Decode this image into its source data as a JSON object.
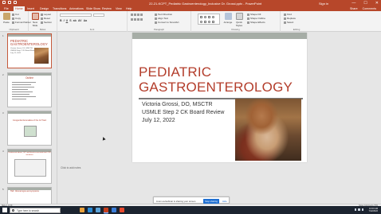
{
  "window": {
    "title": "22-21-KCPT_Pediatric Gastroenterology_Inclusive Dr. Grossi.pptx - PowerPoint",
    "signin": "Sign in",
    "controls": [
      "—",
      "☐",
      "✕"
    ]
  },
  "ribbon_tabs": [
    "File",
    "Home",
    "Insert",
    "Design",
    "Transitions",
    "Animations",
    "Slide Show",
    "Review",
    "View",
    "Help"
  ],
  "ribbon_right": [
    "Share",
    "Comments"
  ],
  "ribbon": {
    "clipboard": {
      "paste": "Paste",
      "cut": "Cut",
      "copy": "Copy",
      "format_painter": "Format Painter",
      "label": "Clipboard"
    },
    "slides": {
      "new_slide": "New Slide",
      "layout": "Layout",
      "reset": "Reset",
      "section": "Section",
      "label": "Slides"
    },
    "font": {
      "label": "Font",
      "format": [
        "B",
        "I",
        "U",
        "S",
        "ab",
        "AV",
        "Aa"
      ]
    },
    "paragraph": {
      "label": "Paragraph",
      "text_direction": "Text Direction",
      "align_text": "Align Text",
      "convert_smartart": "Convert to SmartArt"
    },
    "drawing": {
      "arrange": "Arrange",
      "quick_styles": "Quick Styles",
      "shape_fill": "Shape Fill",
      "shape_outline": "Shape Outline",
      "shape_effects": "Shape Effects",
      "label": "Drawing"
    },
    "editing": {
      "find": "Find",
      "replace": "Replace",
      "select": "Select",
      "label": "Editing"
    }
  },
  "thumbnails": [
    {
      "num": "1",
      "title": "PEDIATRIC GASTROENTEROLOGY",
      "sub": "Victoria Grossi, DO, MSCTR\nUSMLE Step 2 CK Board Review\nJuly 12, 2022"
    },
    {
      "num": "2",
      "title": "Outline"
    },
    {
      "num": "3",
      "title": "Congenital Anomalies of the GI Tract"
    },
    {
      "num": "4",
      "title": "Condensed above, GIT and bleed-associated fetal CKD variations"
    },
    {
      "num": "5",
      "title": "TEF: Clinical signs and symptoms"
    }
  ],
  "slide": {
    "title_line1": "PEDIATRIC",
    "title_line2": "GASTROENTEROLOGY",
    "author": "Victoria Grossi, DO, MSCTR",
    "event": "USMLE Step 2 CK Board Review",
    "date": "July 12, 2022"
  },
  "notes_placeholder": "Click to add notes",
  "share_banner": {
    "text": "zoom.us/webinar is sharing your screen.",
    "stop": "Stop sharing",
    "hide": "Hide"
  },
  "statusbar": {
    "left": "Slide 1 of 39",
    "right": "Notes   Comments   76%"
  },
  "taskbar": {
    "search_placeholder": "Type here to search",
    "time": "10:00 AM",
    "date": "7/12/2022",
    "app_colors": [
      "#e9a13b",
      "#2a8ad4",
      "#5ba3d9",
      "#c43e1c",
      "#3b7dd8",
      "#e84a2e"
    ]
  }
}
